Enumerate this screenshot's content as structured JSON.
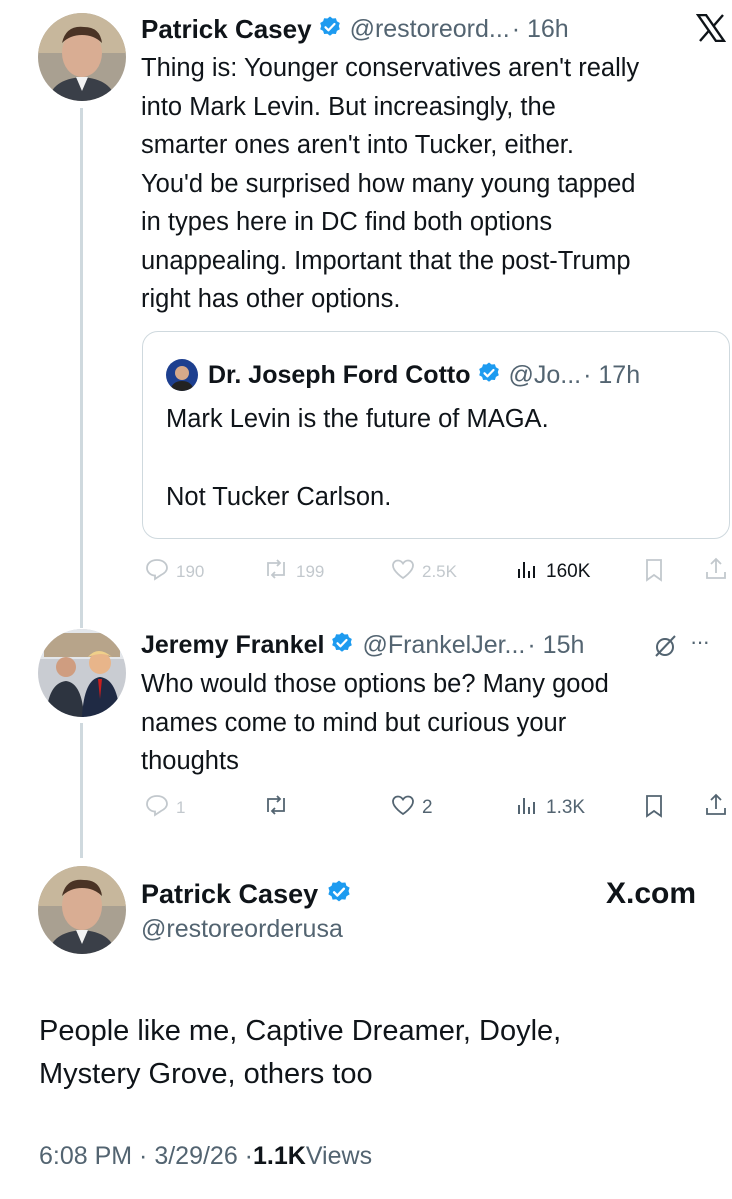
{
  "tweet1": {
    "author_name": "Patrick Casey",
    "author_handle": "@restoreord...",
    "time": "· 16h",
    "text_lines": [
      "Thing is: Younger conservatives aren't really",
      "into Mark Levin. But increasingly, the",
      "smarter ones aren't into Tucker, either.",
      "You'd be surprised how many young tapped",
      "in types here in DC find both options",
      "unappealing. Important that the post-Trump",
      "right has other options."
    ],
    "quote": {
      "author_name": "Dr. Joseph Ford Cotto",
      "author_handle": "@Jo...",
      "time": "· 17h",
      "line1": "Mark Levin is the future of MAGA.",
      "line2": "Not Tucker Carlson."
    },
    "actions": {
      "replies": "190",
      "reposts": "199",
      "likes": "2.5K",
      "views": "160K"
    }
  },
  "tweet2": {
    "author_name": "Jeremy Frankel",
    "author_handle": "@FrankelJer...",
    "time": "· 15h",
    "more": "···",
    "text_lines": [
      "Who would those options be? Many good",
      "names come to mind but curious your",
      "thoughts"
    ],
    "actions": {
      "replies": "1",
      "likes": "2",
      "views": "1.3K"
    }
  },
  "tweet3": {
    "author_name": "Patrick Casey",
    "author_handle": "@restoreorderusa",
    "brand": "X.com",
    "text_lines": [
      "People like me, Captive Dreamer, Doyle,",
      "Mystery Grove, others too"
    ],
    "meta_time": "6:08 PM · 3/29/26 · ",
    "meta_views_count": "1.1K",
    "meta_views_label": " Views"
  },
  "colors": {
    "verified": "#1d9bf0",
    "text": "#0f1419",
    "secondary": "#536471",
    "border": "#cfd9de"
  },
  "icons": [
    "x-logo-icon",
    "verified-badge-icon",
    "reply-icon",
    "repost-icon",
    "like-icon",
    "views-icon",
    "bookmark-icon",
    "share-icon",
    "grok-icon",
    "more-icon"
  ]
}
